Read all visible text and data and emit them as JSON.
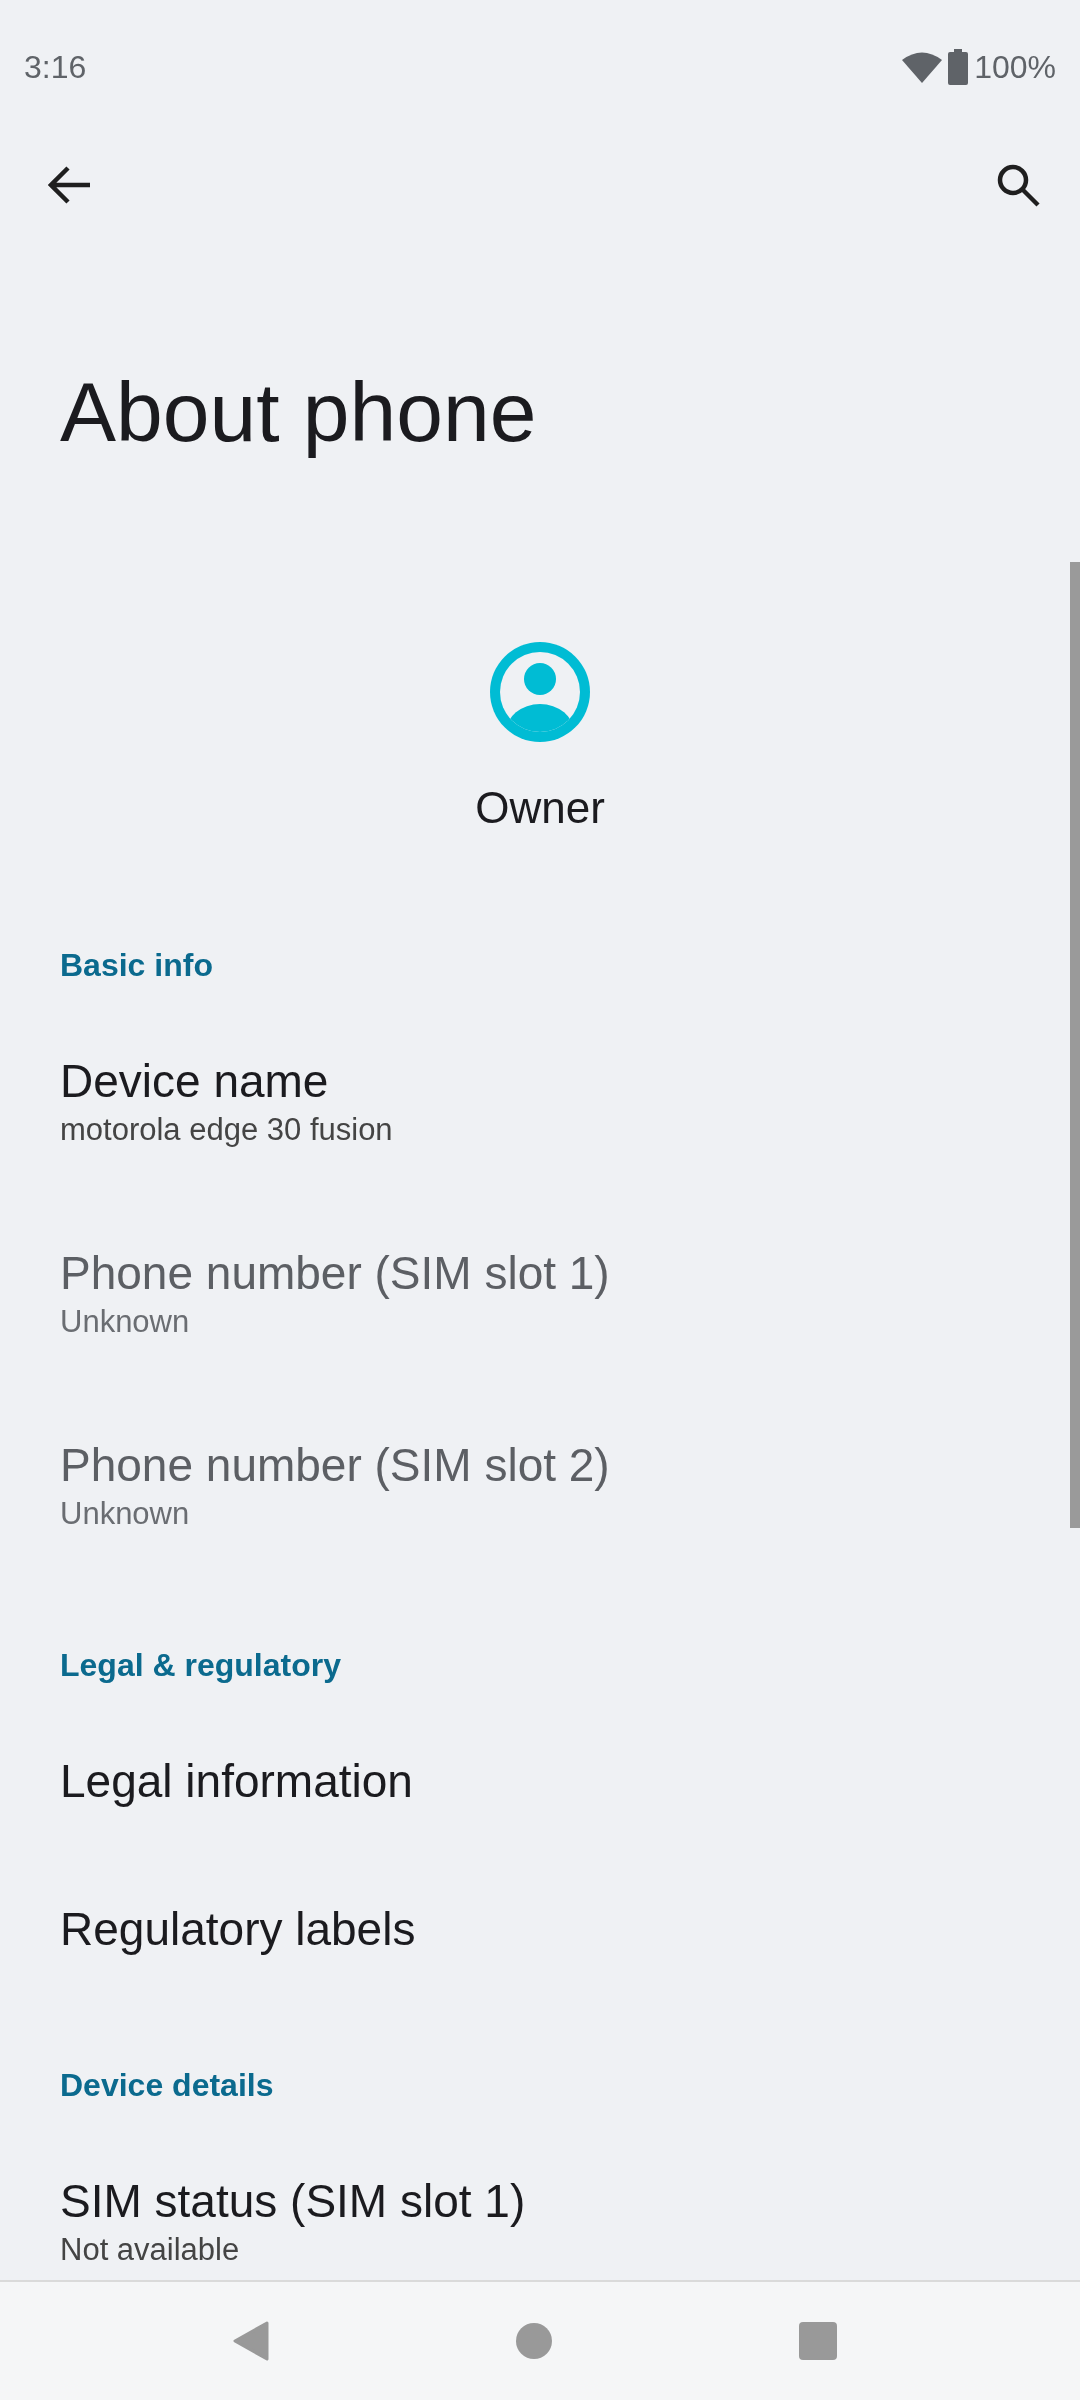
{
  "status_bar": {
    "time": "3:16",
    "battery": "100%"
  },
  "title": "About phone",
  "profile": {
    "name": "Owner"
  },
  "sections": [
    {
      "header": "Basic info",
      "items": [
        {
          "title": "Device name",
          "summary": "motorola edge 30 fusion",
          "disabled": false
        },
        {
          "title": "Phone number (SIM slot 1)",
          "summary": "Unknown",
          "disabled": true
        },
        {
          "title": "Phone number (SIM slot 2)",
          "summary": "Unknown",
          "disabled": true
        }
      ]
    },
    {
      "header": "Legal & regulatory",
      "items": [
        {
          "title": "Legal information",
          "disabled": false
        },
        {
          "title": "Regulatory labels",
          "disabled": false
        }
      ]
    },
    {
      "header": "Device details",
      "items": [
        {
          "title": "SIM status (SIM slot 1)",
          "summary": "Not available",
          "disabled": false
        }
      ]
    }
  ]
}
